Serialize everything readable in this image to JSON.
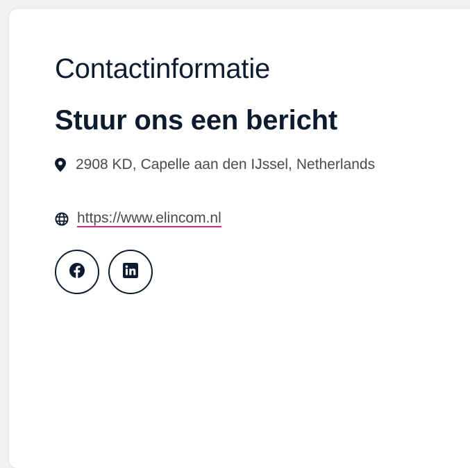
{
  "contact": {
    "eyebrow": "Contactinformatie",
    "heading": "Stuur ons een bericht",
    "address": {
      "icon": "map-marker-icon",
      "postcode": "2908 KD,",
      "city": "Capelle aan den IJssel,",
      "country": "Netherlands"
    },
    "website": {
      "icon": "globe-icon",
      "label": "https://www.elincom.nl"
    },
    "socials": [
      {
        "icon": "facebook-icon",
        "label": "Facebook"
      },
      {
        "icon": "linkedin-icon",
        "label": "LinkedIn"
      }
    ]
  },
  "colors": {
    "text_dark": "#0d1b2e",
    "text_body": "#4a4a4a",
    "link_underline": "#e0218a",
    "card_bg": "#ffffff"
  }
}
